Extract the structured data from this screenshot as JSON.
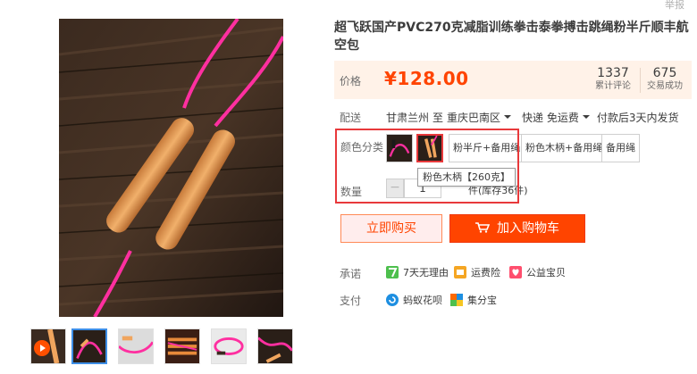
{
  "header": {
    "report": "举报"
  },
  "product": {
    "title": "超飞跃国产PVC270克减脂训练拳击泰拳搏击跳绳粉半斤顺丰航空包",
    "price_label": "价格",
    "price": "¥128.00",
    "reviews_count": "1337",
    "reviews_label": "累计评论",
    "sales_count": "675",
    "sales_label": "交易成功"
  },
  "delivery": {
    "label": "配送",
    "from": "甘肃兰州",
    "to_word": "至",
    "to": "重庆巴南区",
    "shipping": "快递 免运费",
    "promise": "付款后3天内发货"
  },
  "options": {
    "color_label": "颜色分类",
    "items": [
      "粉半斤+备用绳",
      "粉色木柄+备用绳",
      "备用绳"
    ],
    "tooltip": "粉色木柄【260克】"
  },
  "quantity": {
    "label": "数量",
    "minus": "−",
    "value": "1",
    "stock": "件(库存36件)"
  },
  "actions": {
    "buy_now": "立即购买",
    "add_to_cart": "加入购物车"
  },
  "services": {
    "promise_label": "承诺",
    "promise_items": [
      "7天无理由",
      "运费险",
      "公益宝贝"
    ],
    "payment_label": "支付",
    "payment_items": [
      "蚂蚁花呗",
      "集分宝"
    ]
  },
  "colors": {
    "price": "#ff4400",
    "price_bg": "#fff2e8",
    "cart_button": "#ff4400",
    "highlight": "#e8393b",
    "rope": "#ff2fa0"
  }
}
